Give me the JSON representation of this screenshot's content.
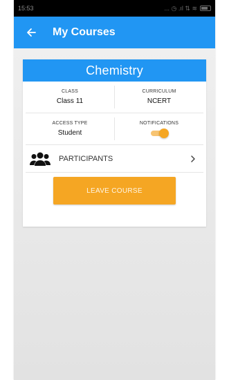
{
  "status_bar": {
    "time": "15:53",
    "indicators": "... ◷ .ıl ⇅ ≋"
  },
  "app_bar": {
    "title": "My Courses",
    "back_icon": "arrow-left-icon",
    "background": "#2196f3"
  },
  "course": {
    "name": "Chemistry",
    "fields": {
      "class_label": "CLASS",
      "class_value": "Class 11",
      "curriculum_label": "CURRICULUM",
      "curriculum_value": "NCERT",
      "access_label": "ACCESS TYPE",
      "access_value": "Student",
      "notifications_label": "NOTIFICATIONS",
      "notifications_on": true
    },
    "participants_label": "PARTICIPANTS",
    "participants_icon": "users-icon",
    "leave_label": "LEAVE COURSE",
    "accent": "#f5a623"
  }
}
